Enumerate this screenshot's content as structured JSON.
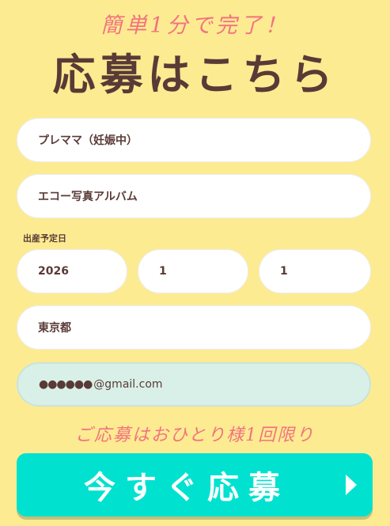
{
  "header": {
    "subheading": "簡単1分で完了！",
    "title": "応募はこちら"
  },
  "form": {
    "status_value": "プレママ（妊娠中）",
    "product_value": "エコー写真アルバム",
    "due_date_label": "出産予定日",
    "due_year": "2026",
    "due_month": "1",
    "due_day": "1",
    "prefecture_value": "東京都",
    "email_mask": "●●●●●●",
    "email_domain": "@gmail.com"
  },
  "footer": {
    "limit_note": "ご応募はおひとり様1回限り",
    "submit_label": "今すぐ応募",
    "submit_arrow_icon": "triangle-right-icon"
  },
  "colors": {
    "background": "#fdeb92",
    "accent_pink": "#f2737f",
    "title_brown": "#5a3a36",
    "button_teal": "#00e2cf",
    "email_field_bg": "#d8f0e8"
  }
}
